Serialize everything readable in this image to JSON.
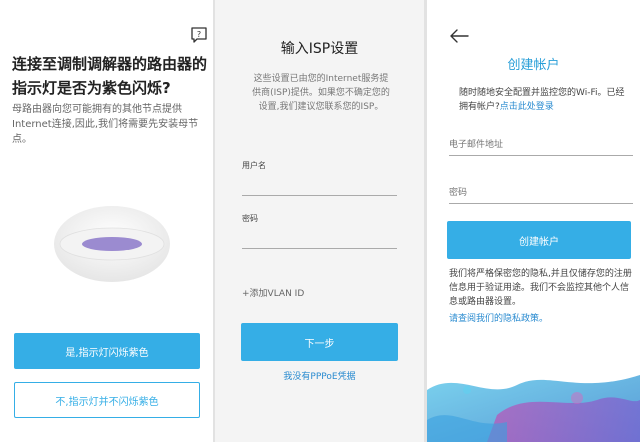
{
  "panel1": {
    "help_icon": "question-bubble-icon",
    "title": "连接至调制调解器的路由器的指示灯是否为紫色闪烁?",
    "description": "母路由器向您可能拥有的其他节点提供Internet连接,因此,我们将需要先安装母节点。",
    "router_image": "router-purple-light",
    "yes_label": "是,指示灯闪烁紫色",
    "no_label": "不,指示灯并不闪烁紫色",
    "colors": {
      "accent": "#35aee6",
      "light": "#9b8bd0"
    }
  },
  "panel2": {
    "title": "输入ISP设置",
    "description": "这些设置已由您的Internet服务提供商(ISP)提供。如果您不确定您的设置,我们建议您联系您的ISP。",
    "username_label": "用户名",
    "password_label": "密码",
    "vlan_label": "+添加VLAN ID",
    "next_label": "下一步",
    "no_pppoe_label": "我没有PPPoE凭据"
  },
  "panel3": {
    "back_icon": "arrow-left-icon",
    "title": "创建帐户",
    "description_text": "随时随地安全配置并监控您的Wi-Fi。已经拥有帐户?",
    "description_link": "点击此处登录",
    "email_placeholder": "电子邮件地址",
    "password_placeholder": "密码",
    "create_label": "创建帐户",
    "privacy_text": "我们将严格保密您的隐私,并且仅储存您的注册信息用于验证用途。我们不会监控其他个人信息或路由器设置。",
    "privacy_link": "请查阅我们的隐私政策。",
    "decoration": "watercolor-splash",
    "colors": {
      "title": "#2a9fd8",
      "link": "#2a8bd0"
    }
  }
}
